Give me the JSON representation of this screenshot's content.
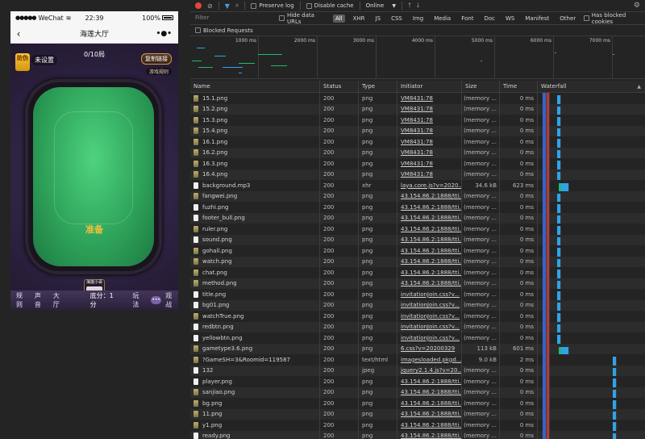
{
  "phone": {
    "status": {
      "carrier": "WeChat",
      "time": "22:39",
      "battery": "100%"
    },
    "nav": {
      "back_icon": "‹",
      "title": "海莲大厅",
      "more_icon": "•●•"
    },
    "game": {
      "round": "0/10局",
      "anti_cheat_label": "防伪",
      "unset_label": "未设置",
      "copy_button": "复制链接",
      "table_mark": "游戏规则",
      "ready_label": "准备",
      "player": {
        "name": "海莲小哥",
        "score": "0"
      },
      "bottom": {
        "rules": "规则",
        "sound": "声音",
        "hall": "大厅",
        "base_score": "底分：1分",
        "play": "玩法",
        "chat": "•••",
        "watch": "观战"
      }
    }
  },
  "devtools": {
    "toolbar": {
      "preserve_log": "Preserve log",
      "disable_cache": "Disable cache",
      "throttle": "Online",
      "throttle_arrow": "▼",
      "upload_icon": "⭡",
      "download_icon": "⭣",
      "settings_icon": "⚙"
    },
    "filter": {
      "placeholder": "Filter",
      "hide_data_urls": "Hide data URLs",
      "types": [
        "All",
        "XHR",
        "JS",
        "CSS",
        "Img",
        "Media",
        "Font",
        "Doc",
        "WS",
        "Manifest",
        "Other"
      ],
      "active_type": "All",
      "has_blocked_cookies": "Has blocked cookies",
      "blocked_requests": "Blocked Requests"
    },
    "overview_ticks": [
      "1000 ms",
      "2000 ms",
      "3000 ms",
      "4000 ms",
      "5000 ms",
      "6000 ms",
      "7000 ms"
    ],
    "columns": {
      "name": "Name",
      "status": "Status",
      "type": "Type",
      "initiator": "Initiator",
      "size": "Size",
      "time": "Time",
      "waterfall": "Waterfall",
      "sort_icon": "▲"
    },
    "rows": [
      {
        "name": "15.1.png",
        "status": "200",
        "type": "png",
        "initiator": "VM8431:78",
        "size": "(memory ...",
        "time": "0 ms",
        "icon": "img"
      },
      {
        "name": "15.2.png",
        "status": "200",
        "type": "png",
        "initiator": "VM8431:78",
        "size": "(memory ...",
        "time": "0 ms",
        "icon": "img"
      },
      {
        "name": "15.3.png",
        "status": "200",
        "type": "png",
        "initiator": "VM8431:78",
        "size": "(memory ...",
        "time": "0 ms",
        "icon": "img"
      },
      {
        "name": "15.4.png",
        "status": "200",
        "type": "png",
        "initiator": "VM8431:78",
        "size": "(memory ...",
        "time": "0 ms",
        "icon": "img"
      },
      {
        "name": "16.1.png",
        "status": "200",
        "type": "png",
        "initiator": "VM8431:78",
        "size": "(memory ...",
        "time": "0 ms",
        "icon": "img"
      },
      {
        "name": "16.2.png",
        "status": "200",
        "type": "png",
        "initiator": "VM8431:78",
        "size": "(memory ...",
        "time": "0 ms",
        "icon": "img"
      },
      {
        "name": "16.3.png",
        "status": "200",
        "type": "png",
        "initiator": "VM8431:78",
        "size": "(memory ...",
        "time": "0 ms",
        "icon": "img"
      },
      {
        "name": "16.4.png",
        "status": "200",
        "type": "png",
        "initiator": "VM8431:78",
        "size": "(memory ...",
        "time": "0 ms",
        "icon": "img"
      },
      {
        "name": "background.mp3",
        "status": "200",
        "type": "xhr",
        "initiator": "laya.core.js?v=2020...",
        "size": "34.6 kB",
        "time": "623 ms",
        "icon": "doc"
      },
      {
        "name": "fangwei.png",
        "status": "200",
        "type": "png",
        "initiator": "43.154.86.2:1888/tti...",
        "size": "(memory ...",
        "time": "0 ms",
        "icon": "img"
      },
      {
        "name": "fuzhi.png",
        "status": "200",
        "type": "png",
        "initiator": "43.154.86.2:1888/tti...",
        "size": "(memory ...",
        "time": "0 ms",
        "icon": "doc"
      },
      {
        "name": "footer_bull.png",
        "status": "200",
        "type": "png",
        "initiator": "43.154.86.2:1888/tti...",
        "size": "(memory ...",
        "time": "0 ms",
        "icon": "doc"
      },
      {
        "name": "ruler.png",
        "status": "200",
        "type": "png",
        "initiator": "43.154.86.2:1888/tti...",
        "size": "(memory ...",
        "time": "0 ms",
        "icon": "img"
      },
      {
        "name": "sound.png",
        "status": "200",
        "type": "png",
        "initiator": "43.154.86.2:1888/tti...",
        "size": "(memory ...",
        "time": "0 ms",
        "icon": "doc"
      },
      {
        "name": "gohall.png",
        "status": "200",
        "type": "png",
        "initiator": "43.154.86.2:1888/tti...",
        "size": "(memory ...",
        "time": "0 ms",
        "icon": "img"
      },
      {
        "name": "watch.png",
        "status": "200",
        "type": "png",
        "initiator": "43.154.86.2:1888/tti...",
        "size": "(memory ...",
        "time": "0 ms",
        "icon": "img"
      },
      {
        "name": "chat.png",
        "status": "200",
        "type": "png",
        "initiator": "43.154.86.2:1888/tti...",
        "size": "(memory ...",
        "time": "0 ms",
        "icon": "img"
      },
      {
        "name": "method.png",
        "status": "200",
        "type": "png",
        "initiator": "43.154.86.2:1888/tti...",
        "size": "(memory ...",
        "time": "0 ms",
        "icon": "img"
      },
      {
        "name": "title.png",
        "status": "200",
        "type": "png",
        "initiator": "invitationJoin.css?v...",
        "size": "(memory ...",
        "time": "0 ms",
        "icon": "doc"
      },
      {
        "name": "bg01.png",
        "status": "200",
        "type": "png",
        "initiator": "invitationJoin.css?v...",
        "size": "(memory ...",
        "time": "0 ms",
        "icon": "doc"
      },
      {
        "name": "watchTrue.png",
        "status": "200",
        "type": "png",
        "initiator": "invitationJoin.css?v...",
        "size": "(memory ...",
        "time": "0 ms",
        "icon": "img"
      },
      {
        "name": "redbtn.png",
        "status": "200",
        "type": "png",
        "initiator": "invitationJoin.css?v...",
        "size": "(memory ...",
        "time": "0 ms",
        "icon": "doc"
      },
      {
        "name": "yellowbtn.png",
        "status": "200",
        "type": "png",
        "initiator": "invitationJoin.css?v...",
        "size": "(memory ...",
        "time": "0 ms",
        "icon": "doc"
      },
      {
        "name": "gametype3.6.png",
        "status": "200",
        "type": "png",
        "initiator": "6.css?v=20200329",
        "size": "113 kB",
        "time": "601 ms",
        "icon": "img"
      },
      {
        "name": "?GameSH=3&Roomid=119587",
        "status": "200",
        "type": "text/html",
        "initiator": "imagesloaded.pkgd...",
        "size": "9.0 kB",
        "time": "2 ms",
        "icon": "img"
      },
      {
        "name": "132",
        "status": "200",
        "type": "jpeg",
        "initiator": "jquery2.1.4.js?v=20...",
        "size": "(memory ...",
        "time": "0 ms",
        "icon": "doc"
      },
      {
        "name": "player.png",
        "status": "200",
        "type": "png",
        "initiator": "43.154.86.2:1888/tti...",
        "size": "(memory ...",
        "time": "0 ms",
        "icon": "doc"
      },
      {
        "name": "sanjiao.png",
        "status": "200",
        "type": "png",
        "initiator": "43.154.86.2:1888/tti...",
        "size": "(memory ...",
        "time": "0 ms",
        "icon": "img"
      },
      {
        "name": "bg.png",
        "status": "200",
        "type": "png",
        "initiator": "43.154.86.2:1888/tti...",
        "size": "(memory ...",
        "time": "0 ms",
        "icon": "img"
      },
      {
        "name": "11.png",
        "status": "200",
        "type": "png",
        "initiator": "43.154.86.2:1888/tti...",
        "size": "(memory ...",
        "time": "0 ms",
        "icon": "img"
      },
      {
        "name": "y1.png",
        "status": "200",
        "type": "png",
        "initiator": "43.154.86.2:1888/tti...",
        "size": "(memory ...",
        "time": "0 ms",
        "icon": "img"
      },
      {
        "name": "ready.png",
        "status": "200",
        "type": "png",
        "initiator": "43.154.86.2:1888/tti...",
        "size": "(memory ...",
        "time": "0 ms",
        "icon": "doc"
      }
    ]
  }
}
